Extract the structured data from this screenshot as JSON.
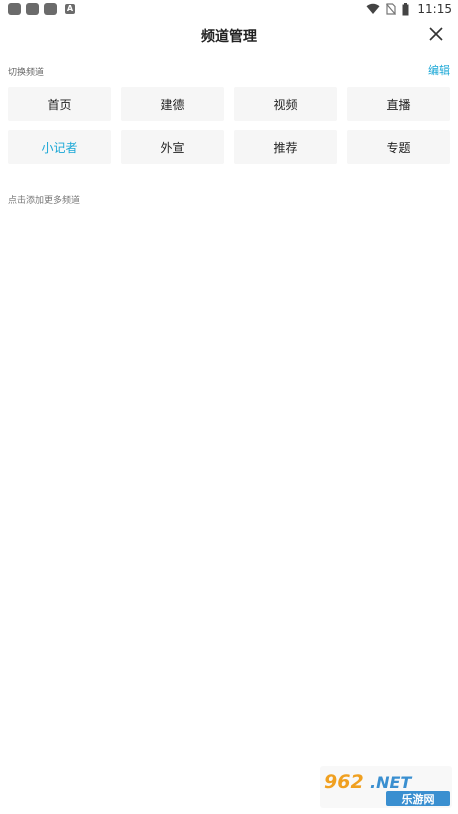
{
  "status_bar": {
    "time": "11:15",
    "notif_badge": "A",
    "icons": [
      "notification-icon",
      "notification-icon",
      "notification-icon",
      "text-notification-icon",
      "wifi-icon",
      "no-sim-icon",
      "battery-icon"
    ]
  },
  "header": {
    "title": "频道管理",
    "close_icon": "close-icon"
  },
  "switch_section": {
    "label": "切换频道",
    "edit_label": "编辑"
  },
  "channels": [
    {
      "label": "首页",
      "active": false
    },
    {
      "label": "建德",
      "active": false
    },
    {
      "label": "视频",
      "active": false
    },
    {
      "label": "直播",
      "active": false
    },
    {
      "label": "小记者",
      "active": true
    },
    {
      "label": "外宣",
      "active": false
    },
    {
      "label": "推荐",
      "active": false
    },
    {
      "label": "专题",
      "active": false
    }
  ],
  "more_section": {
    "label": "点击添加更多频道"
  },
  "watermark": {
    "logo_text": "962.NET",
    "sub_text": "乐游网"
  },
  "colors": {
    "accent": "#1aa7d6",
    "chip_bg": "#f6f6f6"
  }
}
